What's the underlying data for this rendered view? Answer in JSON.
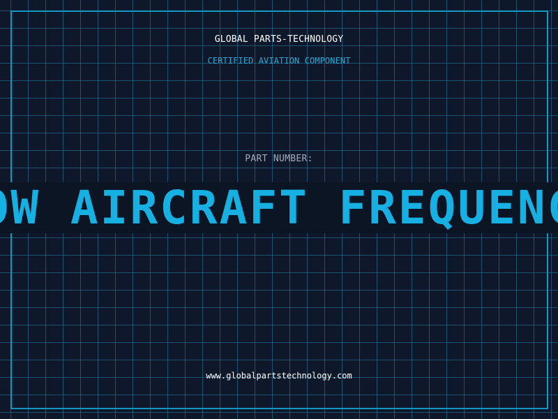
{
  "brand": "GLOBAL PARTS-TECHNOLOGY",
  "subtitle": "CERTIFIED AVIATION COMPONENT",
  "part_label": "PART NUMBER:",
  "part_number": "LOW AIRCRAFT FREQUENCY",
  "url": "www.globalpartstechnology.com",
  "colors": {
    "background": "#0f182b",
    "grid": "#2882a5",
    "border": "#1597c4",
    "accent": "#17b0e3",
    "banner": "#0c1524"
  }
}
